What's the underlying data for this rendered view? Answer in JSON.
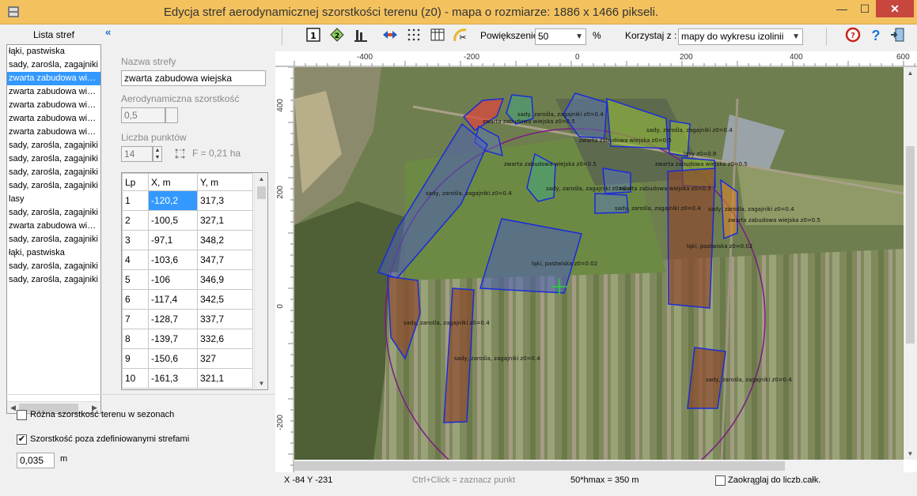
{
  "window": {
    "title": "Edycja stref aerodynamicznej szorstkości terenu (z0)   - mapa o rozmiarze: 1886 x 1466 pikseli.",
    "min": "—",
    "max": "☐",
    "close": "✕"
  },
  "list": {
    "header": "Lista stref",
    "collapse": "«",
    "items": [
      "łąki, pastwiska",
      "sady, zarośla, zagajniki",
      "zwarta zabudowa wiejska",
      "zwarta zabudowa wiejska",
      "zwarta zabudowa wiejska",
      "zwarta zabudowa wiejska",
      "zwarta zabudowa wiejska",
      "sady, zarośla, zagajniki",
      "sady, zarośla, zagajniki",
      "sady, zarośla, zagajniki",
      "sady, zarośla, zagajniki",
      "lasy",
      "sady, zarośla, zagajniki",
      "zwarta zabudowa wiejska",
      "sady, zarośla, zagajniki",
      "łąki, pastwiska",
      "sady, zarośla, zagajniki",
      "sady, zarośla, zagajniki"
    ],
    "selected_index": 2
  },
  "form": {
    "name_label": "Nazwa strefy",
    "name_value": "zwarta zabudowa wiejska",
    "roughness_label": "Aerodynamiczna szorstkość terenu,m",
    "roughness_value": "0,5",
    "points_label": "Liczba punktów",
    "points_value": "14",
    "area_text": "F = 0,21 ha"
  },
  "grid": {
    "headers": [
      "Lp",
      "X, m",
      "Y, m"
    ],
    "rows": [
      [
        "1",
        "-120,2",
        "317,3"
      ],
      [
        "2",
        "-100,5",
        "327,1"
      ],
      [
        "3",
        "-97,1",
        "348,2"
      ],
      [
        "4",
        "-103,6",
        "347,7"
      ],
      [
        "5",
        "-106",
        "346,9"
      ],
      [
        "6",
        "-117,4",
        "342,5"
      ],
      [
        "7",
        "-128,7",
        "337,7"
      ],
      [
        "8",
        "-139,7",
        "332,6"
      ],
      [
        "9",
        "-150,6",
        "327"
      ],
      [
        "10",
        "-161,3",
        "321,1"
      ]
    ]
  },
  "options": {
    "seasonal_label": "Różna szorstkość terenu w sezonach",
    "seasonal_checked": false,
    "outside_label": "Szorstkość poza zdefiniowanymi strefami",
    "outside_checked": true,
    "outside_value": "0,035",
    "outside_unit": "m"
  },
  "toolbar": {
    "zoom_label": "Powiększenie",
    "zoom_value": "50",
    "zoom_unit": "%",
    "use_label": "Korzystaj z :",
    "use_value": "mapy do wykresu izolinii"
  },
  "map": {
    "top_ticks": [
      "-400",
      "-200",
      "0",
      "200",
      "400",
      "600"
    ],
    "left_ticks": [
      "400",
      "200",
      "0",
      "-200"
    ],
    "zone_labels": [
      "zwarta zabudowa wiejska z0=0.5",
      "sady, zarośla, zagajniki z0=0.4",
      "zwarta zabudowa wiejska z0=0.5",
      "sady, zarośla, zagajniki z0=0.4",
      "zwarta zabudowa wiejska z0=0.5",
      "lasy z0=0.8",
      "zwarta zabudowa wiejska z0=0.5",
      "sady, zarośla, zagajniki z0=0.4",
      "sady, zarośla, zagajniki z0=0.4",
      "zwarta zabudowa wiejska z0=0.5",
      "sady, zarośla, zagajniki z0=0.4",
      "sady, zarośla, zagajniki z0=0.4",
      "zwarta zabudowa wiejska z0=0.5",
      "łąki, pastwiska z0=0.02",
      "łąki, pastwiska z0=0.02",
      "sady, zarośla, zagajniki z0=0.4",
      "sady, zarośla, zagajniki z0=0.4",
      "sady, zarośla, zagajniki z0=0.4"
    ]
  },
  "status": {
    "coords": "X -84 Y -231",
    "hint": "Ctrl+Click = zaznacz punkt",
    "hmax": "50*hmax = 350 m",
    "round_label": "Zaokrąglaj do liczb.całk.",
    "round_checked": false
  }
}
